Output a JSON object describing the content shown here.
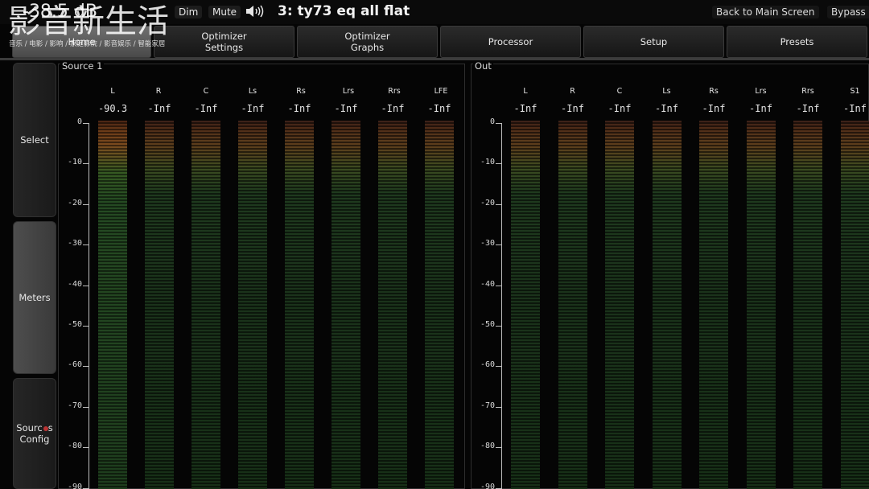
{
  "topbar": {
    "volume": "-38.5 dB",
    "dim_label": "Dim",
    "mute_label": "Mute",
    "speaker_icon": "speaker-volume-icon",
    "preset_name": "3: ty73 eq all flat",
    "back_label": "Back to Main Screen",
    "bypass_label": "Bypass"
  },
  "watermark": {
    "title": "影音新生活",
    "subtitle": "音乐 / 电影 / 影响 / 家庭影院 / 影音娱乐 / 智能家居"
  },
  "tabs": [
    {
      "label": "Home",
      "active": true
    },
    {
      "label": "Optimizer\nSettings"
    },
    {
      "label": "Optimizer\nGraphs"
    },
    {
      "label": "Processor"
    },
    {
      "label": "Setup"
    },
    {
      "label": "Presets"
    }
  ],
  "side_buttons": [
    {
      "label": "Select"
    },
    {
      "label": "Meters",
      "active": true
    },
    {
      "label": "Source\nConfig"
    }
  ],
  "source_panel": {
    "title": "Source 1",
    "channels": [
      {
        "label": "L",
        "value": "-90.3"
      },
      {
        "label": "R",
        "value": "-Inf"
      },
      {
        "label": "C",
        "value": "-Inf"
      },
      {
        "label": "Ls",
        "value": "-Inf"
      },
      {
        "label": "Rs",
        "value": "-Inf"
      },
      {
        "label": "Lrs",
        "value": "-Inf"
      },
      {
        "label": "Rrs",
        "value": "-Inf"
      },
      {
        "label": "LFE",
        "value": "-Inf"
      }
    ]
  },
  "out_panel": {
    "title": "Out",
    "channels": [
      {
        "label": "L",
        "value": "-Inf"
      },
      {
        "label": "R",
        "value": "-Inf"
      },
      {
        "label": "C",
        "value": "-Inf"
      },
      {
        "label": "Ls",
        "value": "-Inf"
      },
      {
        "label": "Rs",
        "value": "-Inf"
      },
      {
        "label": "Lrs",
        "value": "-Inf"
      },
      {
        "label": "Rrs",
        "value": "-Inf"
      },
      {
        "label": "S1",
        "value": "-Inf"
      }
    ]
  },
  "scale": [
    "0",
    "-10",
    "-20",
    "-30",
    "-40",
    "-50",
    "-60",
    "-70",
    "-80",
    "-90"
  ]
}
